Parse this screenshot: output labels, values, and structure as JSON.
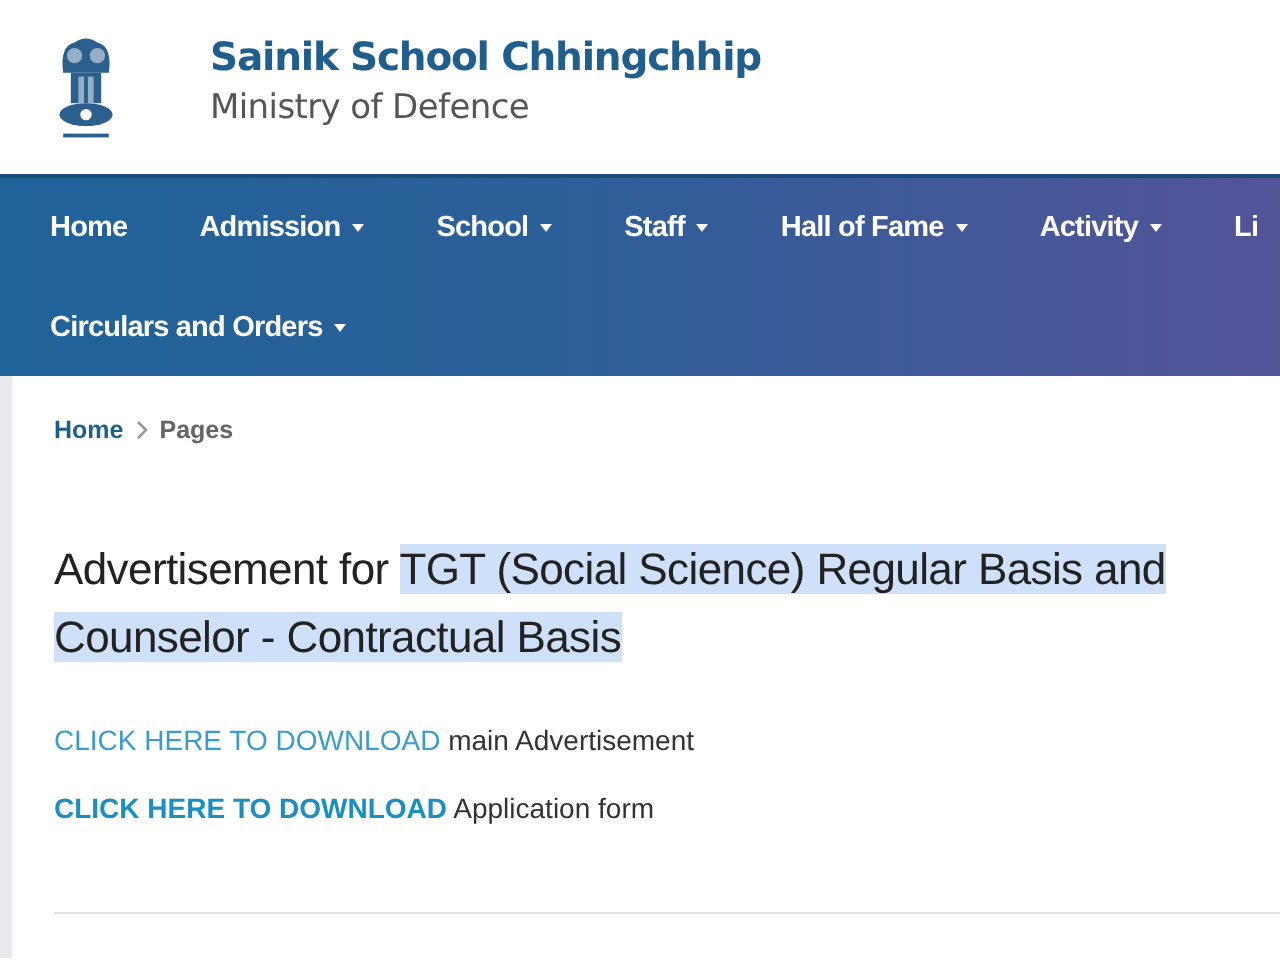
{
  "header": {
    "title": "Sainik School Chhingchhip",
    "subtitle": "Ministry of Defence"
  },
  "nav": [
    {
      "label": "Home",
      "dropdown": false
    },
    {
      "label": "Admission",
      "dropdown": true
    },
    {
      "label": "School",
      "dropdown": true
    },
    {
      "label": "Staff",
      "dropdown": true
    },
    {
      "label": "Hall of Fame",
      "dropdown": true
    },
    {
      "label": "Activity",
      "dropdown": true
    },
    {
      "label": "Li",
      "dropdown": false
    },
    {
      "label": "Circulars and Orders",
      "dropdown": true
    }
  ],
  "breadcrumb": [
    {
      "label": "Home",
      "kind": "link"
    },
    {
      "label": "Pages",
      "kind": "current"
    }
  ],
  "heading": {
    "text": "Advertisement for ",
    "selected_text": "TGT (Social Science) Regular Basis and Counselor - Contractual Basis"
  },
  "downloads": [
    {
      "link": "CLICK HERE TO DOWNLOAD",
      "text": "main Advertisement",
      "bold": false
    },
    {
      "link": "CLICK HERE TO DOWNLOAD",
      "text": "Application form",
      "bold": true
    }
  ]
}
